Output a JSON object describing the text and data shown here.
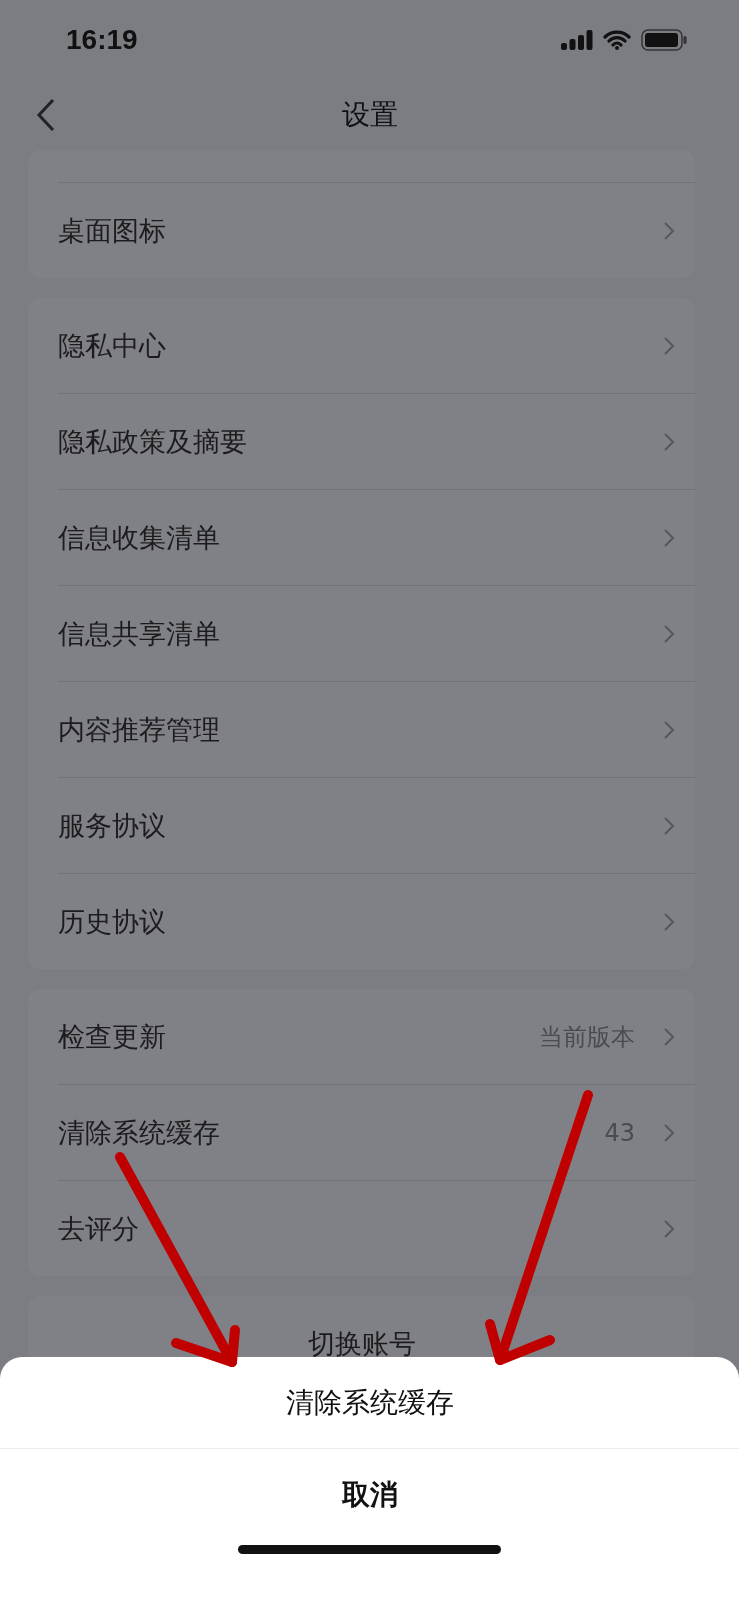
{
  "status_bar": {
    "time": "16:19"
  },
  "nav": {
    "title": "设置"
  },
  "groups": [
    {
      "partial": true,
      "items": [
        {
          "kind": "link",
          "label": "桌面图标"
        }
      ]
    },
    {
      "items": [
        {
          "kind": "link",
          "label": "隐私中心"
        },
        {
          "kind": "link",
          "label": "隐私政策及摘要"
        },
        {
          "kind": "link",
          "label": "信息收集清单"
        },
        {
          "kind": "link",
          "label": "信息共享清单"
        },
        {
          "kind": "link",
          "label": "内容推荐管理"
        },
        {
          "kind": "link",
          "label": "服务协议"
        },
        {
          "kind": "link",
          "label": "历史协议"
        }
      ]
    },
    {
      "items": [
        {
          "kind": "link",
          "label": "检查更新",
          "value": "当前版本"
        },
        {
          "kind": "link",
          "label": "清除系统缓存",
          "value": "43"
        },
        {
          "kind": "link",
          "label": "去评分"
        }
      ]
    },
    {
      "items": [
        {
          "kind": "center",
          "label": "切换账号"
        }
      ]
    }
  ],
  "action_sheet": {
    "options": [
      "清除系统缓存"
    ],
    "cancel": "取消"
  }
}
